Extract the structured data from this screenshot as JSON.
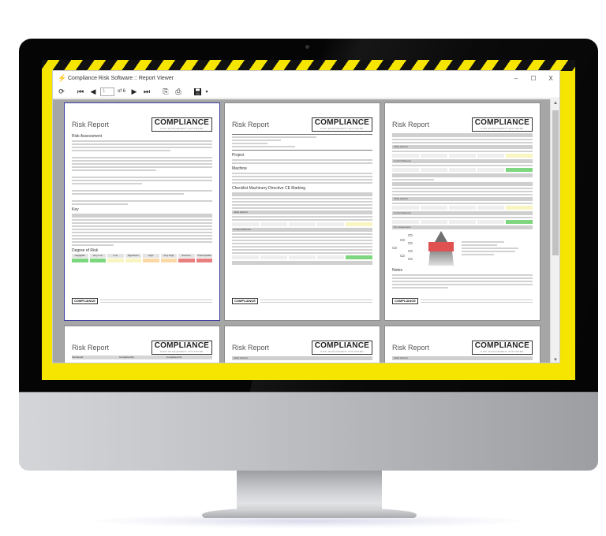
{
  "window": {
    "title": "Compliance Risk Software :: Report Viewer",
    "app_icon": "lightning-icon",
    "controls": {
      "minimize": "–",
      "maximize": "☐",
      "close": "X"
    }
  },
  "toolbar": {
    "refresh_icon": "⟳",
    "first_icon": "⏮",
    "prev_icon": "◀",
    "page_value": "1",
    "page_of": "of 6",
    "next_icon": "▶",
    "last_icon": "⏭",
    "page_setup_icon": "⎘",
    "print_icon": "⎙",
    "save_icon": "▪",
    "save_dropdown": "▾"
  },
  "scrollbar": {
    "up": "▲",
    "down": "▼"
  },
  "pages": [
    {
      "title": "Risk Report",
      "logo_main": "COMPLIANCE",
      "logo_sub": "RISK MANAGEMENT SOFTWARE",
      "section": "Risk Assessment",
      "table_title": "Key",
      "degrees_title": "Degree of Risk",
      "degrees": [
        {
          "label": "Negligible",
          "color": "#7ed67e"
        },
        {
          "label": "Very Low",
          "color": "#7ed67e"
        },
        {
          "label": "Low",
          "color": "#f8f5c0"
        },
        {
          "label": "Significant",
          "color": "#f8f5c0"
        },
        {
          "label": "High",
          "color": "#fbd9a6"
        },
        {
          "label": "Very High",
          "color": "#fbd9a6"
        },
        {
          "label": "Extreme",
          "color": "#e88080"
        },
        {
          "label": "Unacceptable",
          "color": "#e88080"
        }
      ],
      "footer_logo": "COMPLIANCE"
    },
    {
      "title": "Risk Report",
      "logo_main": "COMPLIANCE",
      "logo_sub": "RISK MANAGEMENT SOFTWARE",
      "sections": [
        "Project",
        "Machine",
        "Checklist Machinery Directive CE Marking",
        "Initial Hazard",
        "Control Measure"
      ],
      "footer_logo": "COMPLIANCE"
    },
    {
      "title": "Risk Report",
      "logo_main": "COMPLIANCE",
      "logo_sub": "RISK MANAGEMENT SOFTWARE",
      "sections": [
        "Initial Hazard",
        "Control Measure",
        "Initial Hazard",
        "Control Measure",
        "PLr Assessment",
        "Notes"
      ],
      "footer_logo": "COMPLIANCE"
    },
    {
      "title": "Risk Report",
      "logo_main": "COMPLIANCE",
      "logo_sub": "RISK MANAGEMENT SOFTWARE",
      "headers": [
        "Introduced",
        "Completed By",
        "Completed On"
      ]
    },
    {
      "title": "Risk Report",
      "logo_main": "COMPLIANCE",
      "logo_sub": "RISK MANAGEMENT SOFTWARE",
      "headers": [
        "Initial Hazard"
      ]
    },
    {
      "title": "Risk Report",
      "logo_main": "COMPLIANCE",
      "logo_sub": "RISK MANAGEMENT SOFTWARE",
      "headers": [
        "Initial Hazard"
      ]
    }
  ],
  "colors": {
    "hazard_yellow": "#f6e500",
    "hazard_black": "#111111",
    "risk_green": "#7ed67e",
    "risk_yellow": "#f8f5c0",
    "risk_red": "#e05252"
  }
}
